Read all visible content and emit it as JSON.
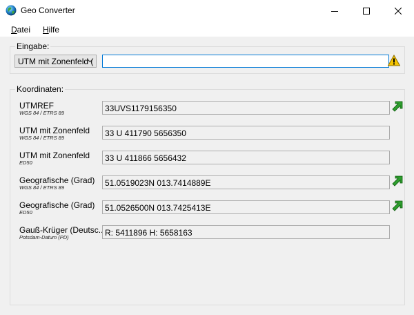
{
  "window": {
    "title": "Geo Converter",
    "icon": "globe-icon"
  },
  "menu": {
    "datei": {
      "accel": "D",
      "rest": "atei"
    },
    "hilfe": {
      "accel": "H",
      "rest": "ilfe"
    }
  },
  "eingabe": {
    "label": "Eingabe:",
    "combo_value": "UTM mit Zonenfeld (",
    "input_value": "",
    "warning_icon": "warning-icon"
  },
  "koordinaten": {
    "label": "Koordinaten:",
    "rows": [
      {
        "label": "UTMREF",
        "sub": "WGS 84 / ETRS 89",
        "value": "33UVS1179156350",
        "arrow": true
      },
      {
        "label": "UTM mit Zonenfeld",
        "sub": "WGS 84 / ETRS 89",
        "value": "33 U 411790 5656350",
        "arrow": false
      },
      {
        "label": "UTM mit Zonenfeld",
        "sub": "ED50",
        "value": "33 U 411866 5656432",
        "arrow": false
      },
      {
        "label": "Geografische (Grad)",
        "sub": "WGS 84 / ETRS 89",
        "value": "51.0519023N 013.7414889E",
        "arrow": true
      },
      {
        "label": "Geografische (Grad)",
        "sub": "ED50",
        "value": "51.0526500N 013.7425413E",
        "arrow": true
      },
      {
        "label": "Gauß-Krüger (Deutsc...",
        "sub": "Potsdam-Datum (PD)",
        "value": "R: 5411896 H: 5658163",
        "arrow": false
      }
    ]
  },
  "colors": {
    "accent": "#0078d7",
    "arrow_green": "#2e9e2e",
    "warning_yellow": "#f5c400"
  }
}
